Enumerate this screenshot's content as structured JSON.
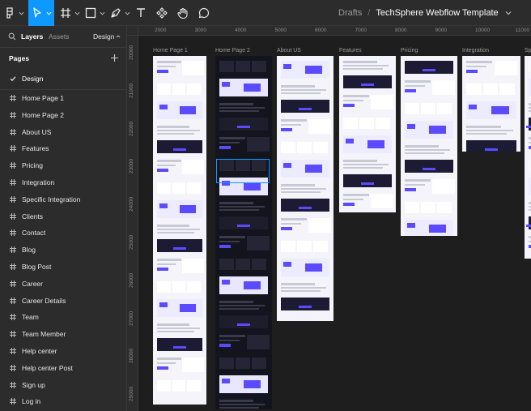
{
  "toolbar": {
    "tools": [
      {
        "name": "main-menu",
        "icon": "figma-logo-icon"
      },
      {
        "name": "move",
        "icon": "cursor-arrow-icon",
        "active": true
      },
      {
        "name": "frame",
        "icon": "frame-hash-icon"
      },
      {
        "name": "shape",
        "icon": "rectangle-icon"
      },
      {
        "name": "pen",
        "icon": "pen-icon"
      },
      {
        "name": "text",
        "icon": "text-t-icon"
      },
      {
        "name": "resources",
        "icon": "components-icon"
      },
      {
        "name": "hand",
        "icon": "hand-icon"
      },
      {
        "name": "comment",
        "icon": "comment-bubble-icon"
      }
    ],
    "breadcrumb": {
      "folder": "Drafts",
      "separator": "/",
      "file": "TechSphere Webflow Template"
    }
  },
  "sidebar": {
    "tabs": {
      "layers": "Layers",
      "assets": "Assets",
      "design": "Design"
    },
    "pages_heading": "Pages",
    "pages": [
      {
        "label": "Design",
        "icon": "check-icon",
        "current": true
      },
      {
        "label": "Home Page 1",
        "icon": "hash-icon"
      },
      {
        "label": "Home Page 2",
        "icon": "hash-icon"
      },
      {
        "label": "About US",
        "icon": "hash-icon"
      },
      {
        "label": "Features",
        "icon": "hash-icon"
      },
      {
        "label": "Pricing",
        "icon": "hash-icon"
      },
      {
        "label": "Integration",
        "icon": "hash-icon"
      },
      {
        "label": "Specific Integration",
        "icon": "hash-icon"
      },
      {
        "label": "Clients",
        "icon": "hash-icon"
      },
      {
        "label": "Contact",
        "icon": "hash-icon"
      },
      {
        "label": "Blog",
        "icon": "hash-icon"
      },
      {
        "label": "Blog Post",
        "icon": "hash-icon"
      },
      {
        "label": "Career",
        "icon": "hash-icon"
      },
      {
        "label": "Career Details",
        "icon": "hash-icon"
      },
      {
        "label": "Team",
        "icon": "hash-icon"
      },
      {
        "label": "Team Member",
        "icon": "hash-icon"
      },
      {
        "label": "Help center",
        "icon": "hash-icon"
      },
      {
        "label": "Help center Post",
        "icon": "hash-icon"
      },
      {
        "label": "Sign up",
        "icon": "hash-icon"
      },
      {
        "label": "Log in",
        "icon": "hash-icon"
      }
    ]
  },
  "canvas": {
    "ruler_x": [
      "2000",
      "3000",
      "4000",
      "5000",
      "6000",
      "7000",
      "8000",
      "9000",
      "10000",
      "11000"
    ],
    "ruler_y": [
      "20000",
      "21000",
      "22000",
      "23000",
      "24000",
      "25000",
      "26000",
      "27000",
      "28000",
      "29000"
    ],
    "frames": [
      {
        "label": "Home Page 1"
      },
      {
        "label": "Home Page 2"
      },
      {
        "label": "About US"
      },
      {
        "label": "Features"
      },
      {
        "label": "Pricing"
      },
      {
        "label": "Integration"
      },
      {
        "label": "Sp"
      }
    ]
  },
  "colors": {
    "accent": "#0d99ff",
    "brand_purple": "#5b4bff",
    "panel_bg": "#2c2c2c",
    "canvas_bg": "#1e1e1e"
  }
}
